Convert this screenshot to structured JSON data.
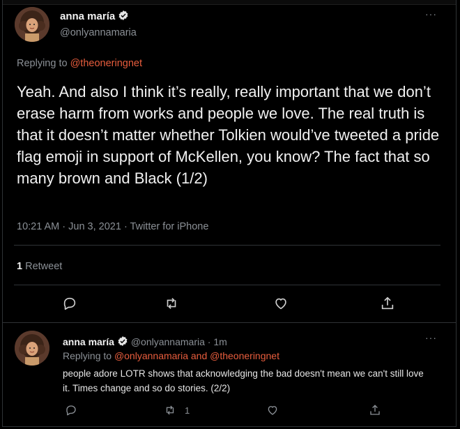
{
  "main_tweet": {
    "author_name": "anna maría",
    "author_handle": "@onlyannamaria",
    "more_label": "···",
    "replying_prefix": "Replying to",
    "replying_to": "@theoneringnet",
    "text": "Yeah. And also I think it’s really, really important that we don’t erase harm from works and people we love. The real truth is that it doesn’t matter whether Tolkien would’ve tweeted a pride flag emoji in support of McKellen, you know? The fact that so many brown and Black (1/2)",
    "timestamp": "10:21 AM · Jun 3, 2021 · Twitter for iPhone",
    "retweet_count": "1",
    "retweet_label": "Retweet",
    "actions": [
      "reply-icon",
      "retweet-icon",
      "like-icon",
      "share-icon"
    ]
  },
  "reply_tweet": {
    "author_name": "anna maría",
    "author_handle": "@onlyannamaria",
    "time_ago": "· 1m",
    "more_label": "···",
    "replying_prefix": "Replying to",
    "replying_to": "@onlyannamaria and @theoneringnet",
    "text": "people adore LOTR shows that acknowledging the bad doesn't mean we can't still love it. Times change and so do stories. (2/2)",
    "retweet_count": "1"
  },
  "colors": {
    "background": "#000000",
    "link": "#e85d3d",
    "muted": "#8b9096",
    "verified": "#e6e6e6"
  }
}
